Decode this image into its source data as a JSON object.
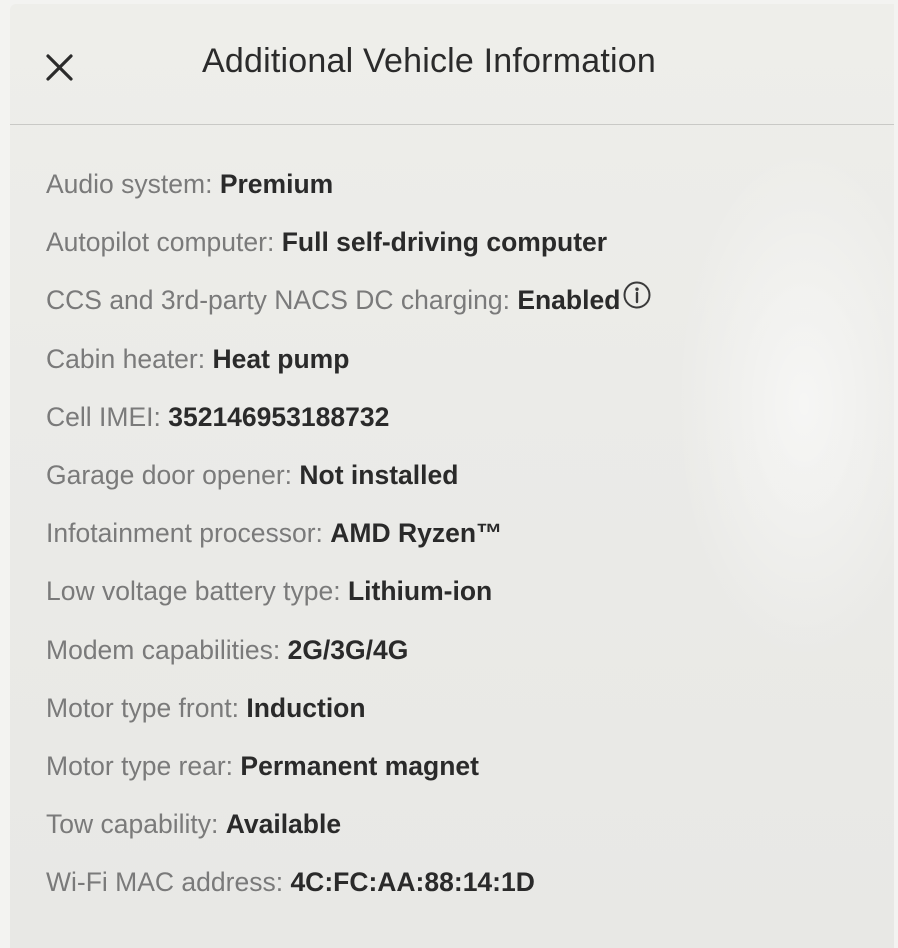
{
  "dialog": {
    "title": "Additional Vehicle Information",
    "close_icon": "close-icon"
  },
  "items": [
    {
      "label": "Audio system:",
      "value": "Premium"
    },
    {
      "label": "Autopilot computer:",
      "value": "Full self-driving computer"
    },
    {
      "label": "CCS and 3rd-party NACS DC charging:",
      "value": "Enabled",
      "icon": "info-icon"
    },
    {
      "label": "Cabin heater:",
      "value": "Heat pump"
    },
    {
      "label": "Cell IMEI:",
      "value": "352146953188732"
    },
    {
      "label": "Garage door opener:",
      "value": "Not installed"
    },
    {
      "label": "Infotainment processor:",
      "value": "AMD Ryzen™"
    },
    {
      "label": "Low voltage battery type:",
      "value": "Lithium-ion"
    },
    {
      "label": "Modem capabilities:",
      "value": "2G/3G/4G"
    },
    {
      "label": "Motor type front:",
      "value": "Induction"
    },
    {
      "label": "Motor type rear:",
      "value": "Permanent magnet"
    },
    {
      "label": "Tow capability:",
      "value": "Available"
    },
    {
      "label": "Wi-Fi MAC address:",
      "value": "4C:FC:AA:88:14:1D"
    }
  ]
}
